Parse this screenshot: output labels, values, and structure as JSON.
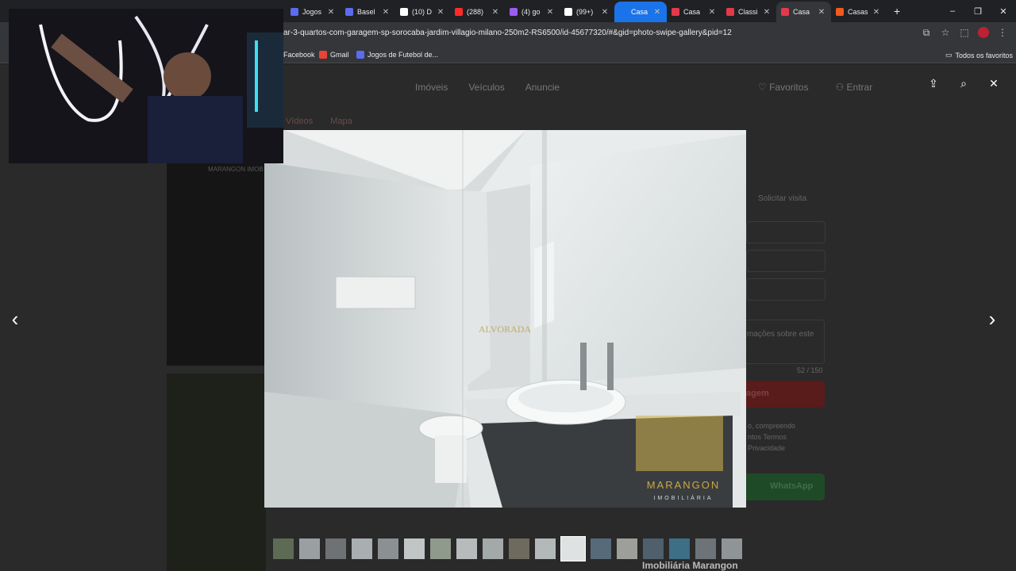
{
  "browser": {
    "tabs": [
      {
        "label": "Jogos",
        "color": "#5b6cf0"
      },
      {
        "label": "Basel",
        "color": "#5b6cf0"
      },
      {
        "label": "(10) D",
        "color": "#ffffff"
      },
      {
        "label": "(288)",
        "color": "#ff2a2a"
      },
      {
        "label": "(4) go",
        "color": "#9b5cf0"
      },
      {
        "label": "(99+)",
        "color": "#ffffff"
      },
      {
        "label": "Casa",
        "color": "#1a73e8"
      },
      {
        "label": "Casa",
        "color": "#e23a4a"
      },
      {
        "label": "Classi",
        "color": "#e23a4a"
      },
      {
        "label": "Casa",
        "color": "#e23a4a"
      },
      {
        "label": "Casas",
        "color": "#f05a1a"
      }
    ],
    "url": "ar-3-quartos-com-garagem-sp-sorocaba-jardim-villagio-milano-250m2-RS6500/id-45677320/#&gid=photo-swipe-gallery&pid=12",
    "bookmarks": [
      {
        "label": "Facebook",
        "color": "#1877f2"
      },
      {
        "label": "Gmail",
        "color": "#ea4335"
      },
      {
        "label": "Jogos de Futebol de...",
        "color": "#5b6cf0"
      }
    ],
    "all_bookmarks": "Todos os favoritos"
  },
  "page": {
    "nav": [
      "Imóveis",
      "Veículos",
      "Anuncie"
    ],
    "favorites": "Favoritos",
    "login": "Entrar",
    "subtabs": [
      "Vídeos",
      "Mapa"
    ],
    "request_visit": "Solicitar visita",
    "info_text": "mações sobre este",
    "char_count": "52 / 150",
    "message_button": "agem",
    "terms_line1": "o, compreendo",
    "terms_line2": "ntos Termos",
    "terms_line3": "Privacidade",
    "whatsapp": "WhatsApp",
    "agency": "Imobiliária Marangon",
    "watermark_top": "MARANGON IMOB"
  },
  "lightbox": {
    "photo_watermark_center": "ALVORADA",
    "photo_watermark_logo": "MARANGON",
    "photo_watermark_sub": "IMOBILIÁRIA",
    "thumbnail_count": 18,
    "active_thumbnail": 12
  },
  "icons": {
    "favorites": "heart-icon",
    "login": "user-icon",
    "share": "share-icon",
    "zoom": "zoom-icon",
    "close": "close-icon",
    "prev": "chevron-left-icon",
    "next": "chevron-right-icon"
  }
}
